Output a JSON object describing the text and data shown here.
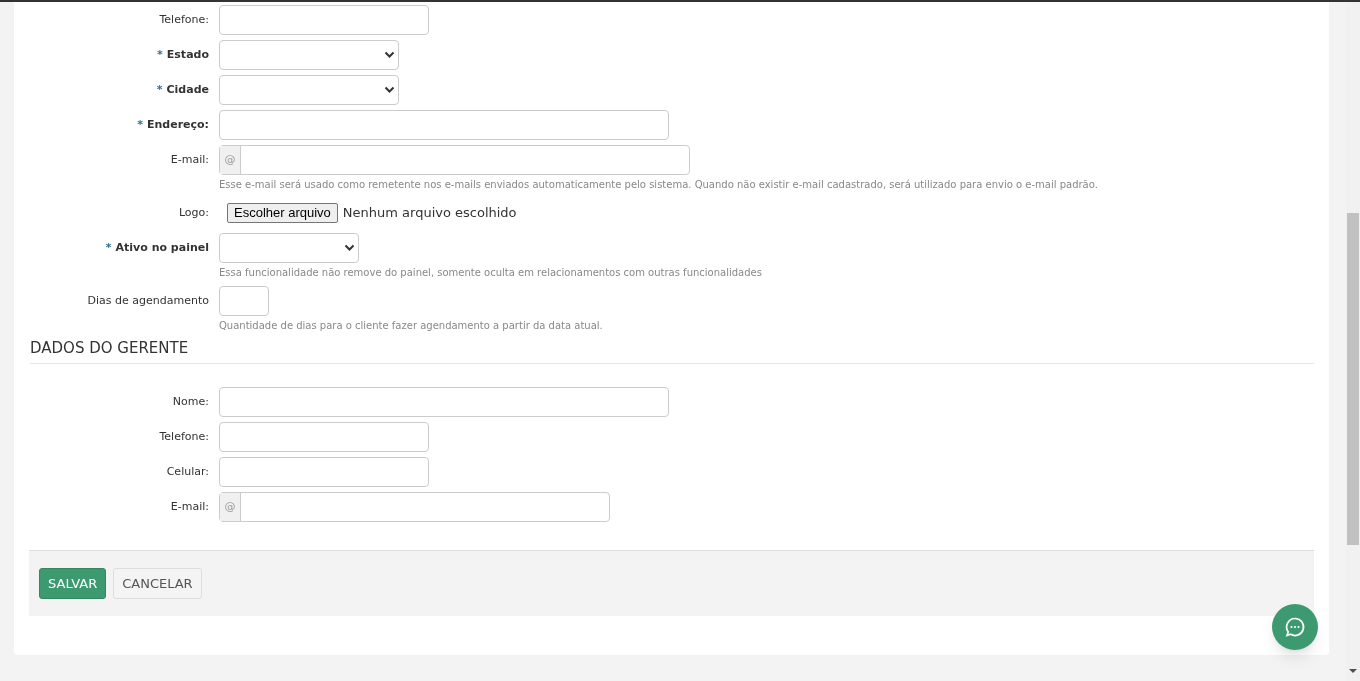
{
  "form": {
    "fields": [
      {
        "kind": "text",
        "label": "Telefone:",
        "required": false
      },
      {
        "kind": "select",
        "label": "Estado",
        "required": true,
        "mark": "*"
      },
      {
        "kind": "select",
        "label": "Cidade",
        "required": true,
        "mark": "*"
      },
      {
        "kind": "text",
        "label": "Endereço:",
        "required": true,
        "mark": "*"
      },
      {
        "kind": "email",
        "label": "E-mail:",
        "required": false,
        "addon": "@",
        "help": "Esse e-mail será usado como remetente nos e-mails enviados automaticamente pelo sistema. Quando não existir e-mail cadastrado, será utilizado para envio o e-mail padrão."
      },
      {
        "kind": "file",
        "label": "Logo:",
        "required": false,
        "button": "Escolher arquivo",
        "status": "Nenhum arquivo escolhido"
      },
      {
        "kind": "select",
        "label": "Ativo no painel",
        "required": true,
        "mark": "*",
        "help": "Essa funcionalidade não remove do painel, somente oculta em relacionamentos com outras funcionalidades"
      },
      {
        "kind": "text",
        "label": "Dias de agendamento",
        "required": false,
        "help": "Quantidade de dias para o cliente fazer agendamento a partir da data atual."
      }
    ]
  },
  "manager_section": {
    "title": "DADOS DO GERENTE",
    "fields": [
      {
        "kind": "text",
        "label": "Nome:",
        "required": false
      },
      {
        "kind": "text",
        "label": "Telefone:",
        "required": false
      },
      {
        "kind": "text",
        "label": "Celular:",
        "required": false
      },
      {
        "kind": "email",
        "label": "E-mail:",
        "required": false,
        "addon": "@"
      }
    ]
  },
  "actions": [
    {
      "kind": "primary",
      "label": "SALVAR"
    },
    {
      "kind": "secondary",
      "label": "CANCELAR"
    }
  ]
}
